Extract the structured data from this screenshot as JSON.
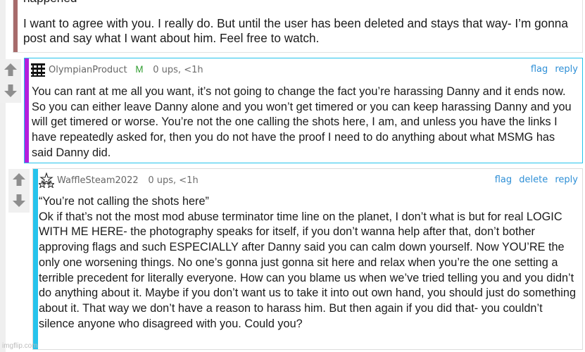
{
  "comments": [
    {
      "text_lines": [
        "happened",
        "I want to agree with you. I really do. But until the user has been deleted and stays that way- I’m gonna post and say what I want about him. Feel free to watch."
      ]
    },
    {
      "username": "OlympianProduct",
      "mod_badge": "M",
      "meta": "0 ups, <1h",
      "actions": {
        "flag": "flag",
        "reply": "reply"
      },
      "body": "You can rant at me all you want, it’s not going to change the fact you’re harassing Danny and it ends now. So you can either leave Danny alone and you won’t get timered or you can keep harassing Danny and you will get timered or worse. You’re not the one calling the shots here, I am, and unless you have the links I have repeatedly asked for, then you do not have the proof I need to do anything about what MSMG has said Danny did."
    },
    {
      "username": "WaffleSteam2022",
      "meta": "0 ups, <1h",
      "actions": {
        "flag": "flag",
        "delete": "delete",
        "reply": "reply"
      },
      "quote": "“You’re not calling the shots here”",
      "body": "Ok if that’s not the most mod abuse terminator time line on the planet, I don’t what is but for real LOGIC WITH ME HERE- the photography speaks for itself, if you don’t wanna help after that, don’t bother approving flags and such ESPECIALLY after Danny said you can calm down yourself. Now YOU’RE the only one worsening things. No one’s gonna just gonna sit here and relax when you’re the one setting a terrible precedent for literally everyone. How can you blame us when we’ve tried telling you and you didn’t do anything about it. Maybe if you don’t want us to take it into out own hand, you should just do something about it. That way we don’t have a reason to harass him. But then again if you did that- you couldn’t silence anyone who disagreed with you. Could you?"
    }
  ],
  "watermark": "imgflip.com",
  "icons": {
    "upvote": "up-arrow-icon",
    "downvote": "down-arrow-icon"
  },
  "colors": {
    "accent_link": "#2e8fd6",
    "mod_bar": "#b31fdc",
    "reply_border": "#26c3ec",
    "top_bar": "#a76b6b",
    "mod_badge": "#2f9d2f"
  }
}
